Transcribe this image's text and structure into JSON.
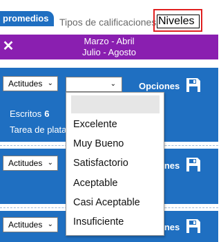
{
  "header": {
    "tab_promedios": "promedios",
    "tipos_label": "Tipos de calificaciones",
    "niveles_value": "Niveles"
  },
  "banner": {
    "close_glyph": "✕",
    "period_1": "Marzo - Abril",
    "period_2": "Julio - Agosto"
  },
  "sections": [
    {
      "select_label": "Actitudes",
      "options_label": "Opciones"
    },
    {
      "select_label": "Actitudes",
      "options_label": "Opciones"
    },
    {
      "select_label": "Actitudes",
      "options_label": "Opciones"
    }
  ],
  "stats": {
    "escritos_label": "Escritos",
    "escritos_value": "6",
    "tarea_label": "Tarea de plata"
  },
  "dropdown": {
    "selected": "",
    "options": [
      "Excelente",
      "Muy Bueno",
      "Satisfactorio",
      "Aceptable",
      "Casi Aceptable",
      "Insuficiente"
    ]
  },
  "icons": {
    "save": "save-icon",
    "chevron": "chevron-down-icon",
    "close": "close-icon"
  },
  "colors": {
    "blue": "#1f6fc1",
    "purple": "#8a1fb0",
    "highlight": "#e02020"
  }
}
